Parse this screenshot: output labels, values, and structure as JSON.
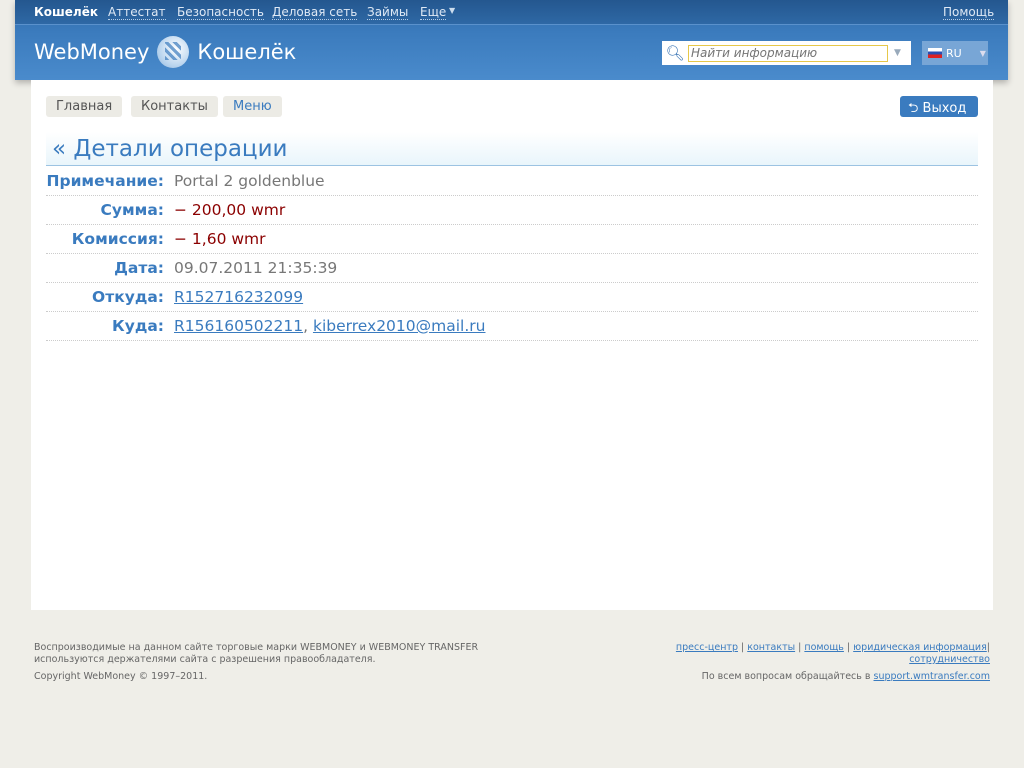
{
  "topnav": {
    "items": [
      "Кошелёк",
      "Аттестат",
      "Безопасность",
      "Деловая сеть",
      "Займы",
      "Еще"
    ],
    "help": "Помощь"
  },
  "logo": {
    "brand": "WebMoney",
    "product": "Кошелёк"
  },
  "search": {
    "placeholder": "Найти информацию"
  },
  "lang": {
    "code": "RU"
  },
  "tabs": [
    "Главная",
    "Контакты",
    "Меню"
  ],
  "logout": "Выход",
  "title": "« Детали операции",
  "details": [
    {
      "label": "Примечание:",
      "value": "Portal 2 goldenblue"
    },
    {
      "label": "Сумма:",
      "value": "− 200,00 wmr"
    },
    {
      "label": "Комиссия:",
      "value": "− 1,60 wmr"
    },
    {
      "label": "Дата:",
      "value": "09.07.2011 21:35:39"
    },
    {
      "label": "Откуда:",
      "value": "R152716232099"
    },
    {
      "label": "Куда:",
      "value": "R156160502211",
      "value2": "kiberrex2010@mail.ru"
    }
  ],
  "footer": {
    "trademark": "Воспроизводимые на данном сайте торговые марки WEBMONEY и WEBMONEY TRANSFER используются держателями сайта с разрешения правообладателя.",
    "copyright": "Copyright WebMoney © 1997–2011.",
    "links": [
      "пресс-центр",
      "контакты",
      "помощь",
      "юридическая информация",
      "сотрудничество"
    ],
    "support_text": "По всем вопросам обращайтесь в",
    "support_link": "support.wmtransfer.com"
  }
}
